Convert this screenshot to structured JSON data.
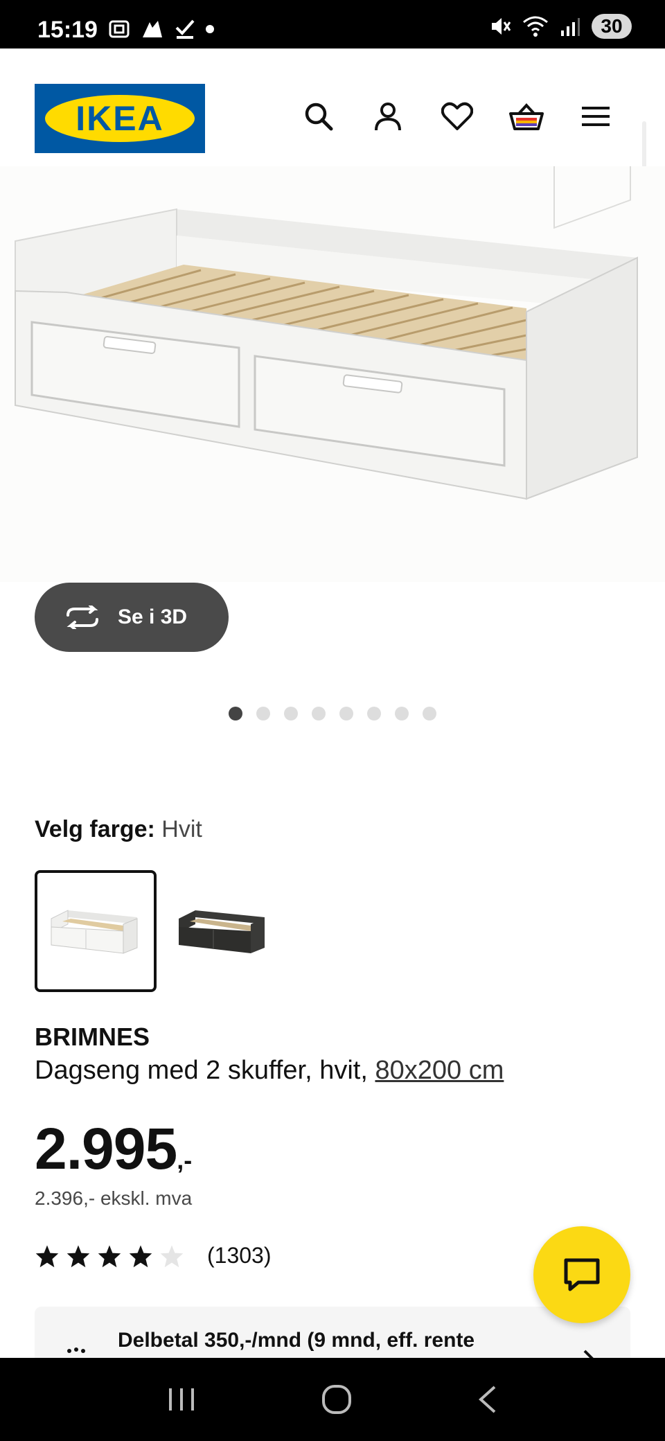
{
  "status_bar": {
    "time": "15:19",
    "battery": "30"
  },
  "header": {
    "logo_text": "IKEA",
    "icons": [
      "search-icon",
      "account-icon",
      "heart-icon",
      "basket-icon",
      "menu-icon"
    ]
  },
  "gallery": {
    "view_3d_label": "Se i 3D",
    "total_images": 8,
    "active_index": 0
  },
  "color_picker": {
    "label": "Velg farge:",
    "value": "Hvit",
    "options": [
      "white",
      "black-brown"
    ],
    "selected": "white"
  },
  "product": {
    "name": "BRIMNES",
    "description": "Dagseng med 2 skuffer, hvit,",
    "size_link": "80x200 cm",
    "price_main": "2.995",
    "price_suffix": ",-",
    "price_ex_vat": "2.396,- ekskl. mva",
    "rating": 4,
    "rating_max": 5,
    "review_count": "(1303)"
  },
  "installment": {
    "text": "Delbetal 350,-/mnd (9 mnd, eff. rente"
  },
  "colors": {
    "ikea_blue": "#0058a3",
    "ikea_yellow": "#ffdb00",
    "chat_yellow": "#fbd914",
    "btn_dark": "#4a4a4a"
  }
}
